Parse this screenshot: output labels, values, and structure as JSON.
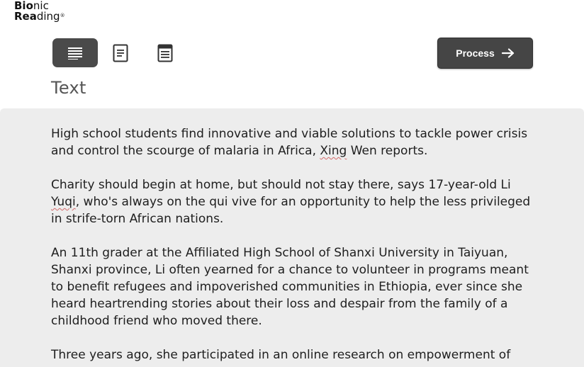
{
  "logo": {
    "line1": "Bionic",
    "line2": "Reading",
    "mark": "®"
  },
  "toolbar": {
    "views": [
      {
        "icon": "justified-text-icon",
        "active": true
      },
      {
        "icon": "document-icon",
        "active": false
      },
      {
        "icon": "page-layout-icon",
        "active": false
      }
    ],
    "process_label": "Process",
    "process_icon": "arrow-right-icon"
  },
  "page": {
    "title": "Text"
  },
  "editor": {
    "paragraphs": [
      {
        "before": "High school students find innovative and viable solutions to tackle power crisis and control the scourge of malaria in Africa, ",
        "flagged": "Xing",
        "after": " Wen reports."
      },
      {
        "before": "Charity should begin at home, but should not stay there, says 17-year-old Li ",
        "flagged": "Yuqi",
        "after": ", who's always on the qui vive for an opportunity to help the less privileged in strife-torn African nations."
      },
      {
        "text": "An 11th grader at the Affiliated High School of Shanxi University in Taiyuan, Shanxi province, Li often yearned for a chance to volunteer in programs meant to benefit refugees and impoverished communities in Ethiopia, ever since she heard heartrending stories about their loss and despair from the family of a childhood friend who moved there."
      },
      {
        "text": "Three years ago, she participated in an online research on empowerment of"
      }
    ]
  },
  "colors": {
    "accent": "#454545",
    "active_view": "#4a4a4a",
    "editor_bg": "#ededed",
    "spell_underline": "#d46a6a"
  }
}
